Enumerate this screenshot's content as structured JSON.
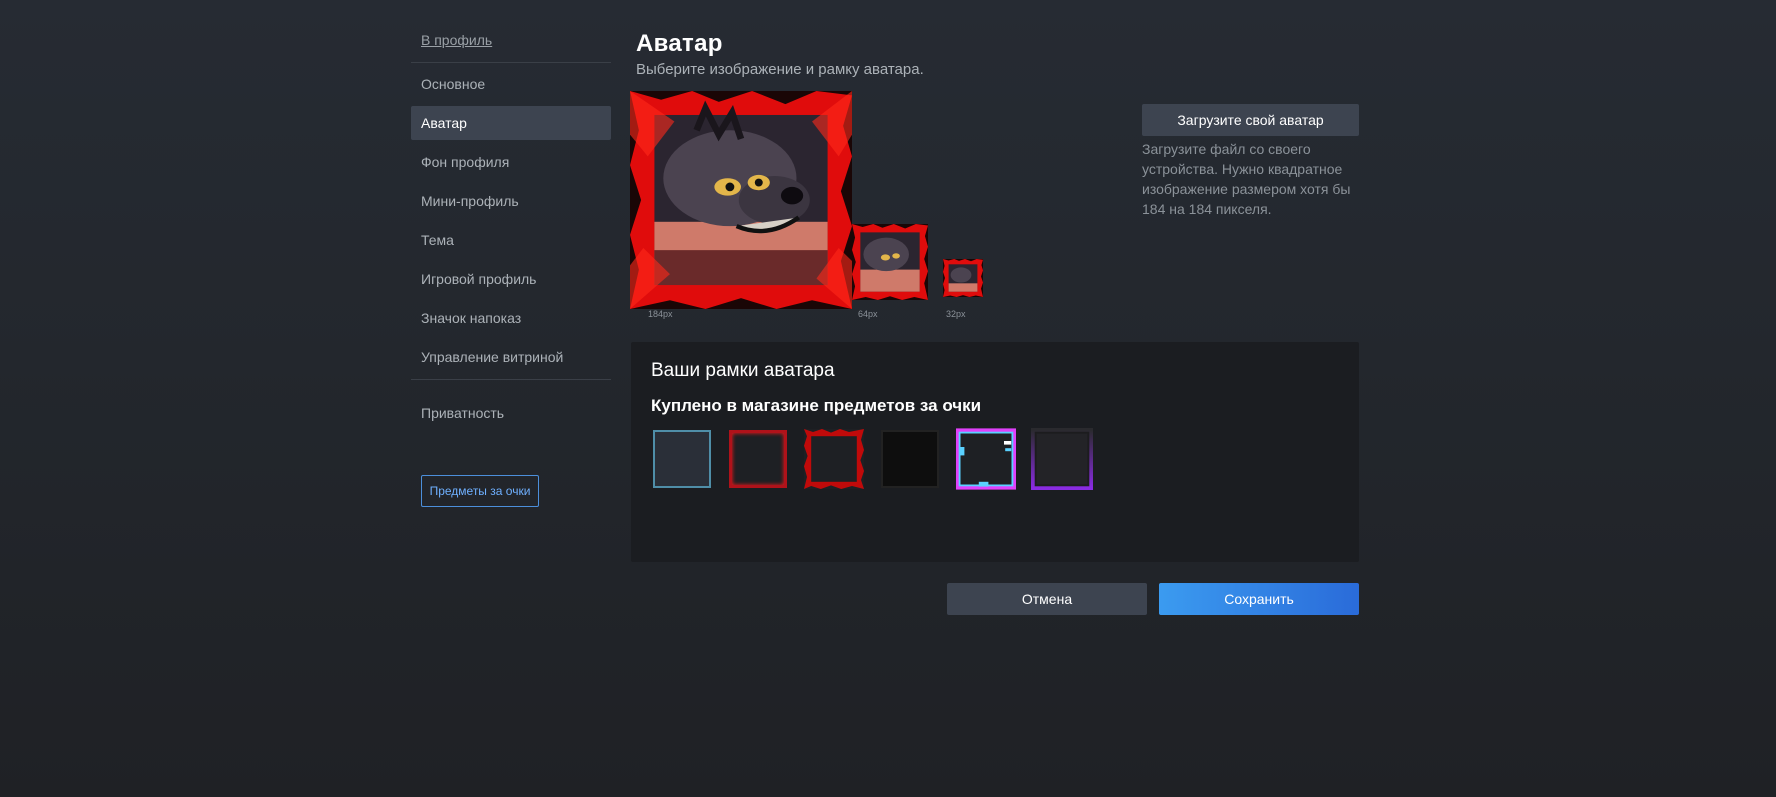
{
  "sidebar": {
    "back_link": "В профиль",
    "items": [
      {
        "label": "Основное"
      },
      {
        "label": "Аватар"
      },
      {
        "label": "Фон профиля"
      },
      {
        "label": "Мини-профиль"
      },
      {
        "label": "Тема"
      },
      {
        "label": "Игровой профиль"
      },
      {
        "label": "Значок напоказ"
      },
      {
        "label": "Управление витриной"
      }
    ],
    "privacy": "Приватность",
    "points_button": "Предметы за очки",
    "active_item": "Аватар"
  },
  "main": {
    "title": "Аватар",
    "subtitle": "Выберите изображение и рамку аватара.",
    "size_labels": {
      "large": "184px",
      "medium": "64px",
      "small": "32px"
    },
    "avatar_icon": "hyena-avatar-with-red-spiky-frame",
    "upload_button": "Загрузите свой аватар",
    "upload_description": "Загрузите файл со своего устройства. Нужно квадратное изображение размером хотя бы 184 на 184 пикселя."
  },
  "frames_panel": {
    "title": "Ваши рамки аватара",
    "subtitle": "Куплено в магазине предметов за очки",
    "frames": [
      {
        "name": "no-frame",
        "color": "#4f8ea8"
      },
      {
        "name": "red-glow-frame",
        "color": "#b0121a"
      },
      {
        "name": "red-spiky-frame",
        "color": "#d01010"
      },
      {
        "name": "dark-smoke-frame",
        "color": "#111111"
      },
      {
        "name": "pink-glitch-frame",
        "color": "#e040fb"
      },
      {
        "name": "purple-gradient-frame",
        "color": "#7b2ff7"
      }
    ]
  },
  "actions": {
    "cancel": "Отмена",
    "save": "Сохранить"
  },
  "colors": {
    "accent": "#2a6bd9",
    "link": "#6fb0ff",
    "active_nav_bg": "#3d4450"
  }
}
